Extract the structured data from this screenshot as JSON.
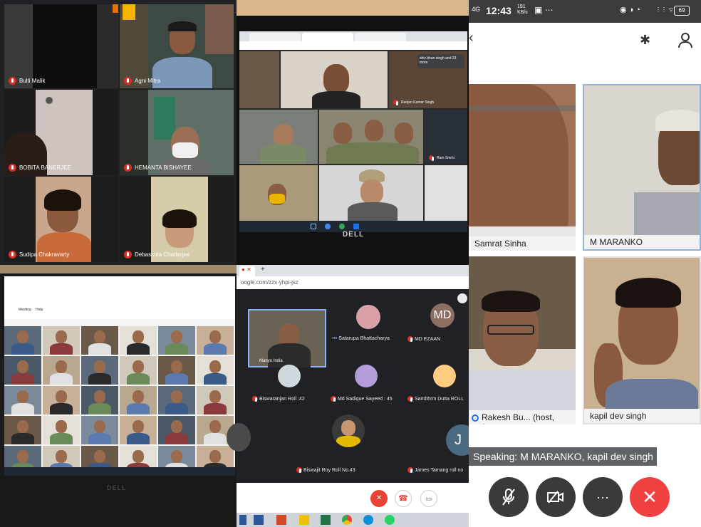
{
  "q1": {
    "participants": [
      {
        "name": "Bulti Malik"
      },
      {
        "name": "Agni Mitra"
      },
      {
        "name": "BOBITA BANERJEE"
      },
      {
        "name": "HEMANTA BISHAYEE"
      },
      {
        "name": "Sudipa Chakravarty"
      },
      {
        "name": "Debasmita Chatterjee"
      }
    ]
  },
  "q2": {
    "participants_label": "shiv bhan singh and 23 more",
    "tiles": [
      {
        "name": "Ranjan Kumar Singh"
      },
      {
        "name": "Ram Snehi"
      }
    ],
    "brand": "DELL"
  },
  "q3": {
    "menu": [
      "Meeting",
      "Help"
    ],
    "brand": "DELL"
  },
  "q4": {
    "url": "oogle.com/zzx-yhpi-jsz",
    "tiles": [
      {
        "name": "Satarupa Bhattacharya"
      },
      {
        "name": "MD EZAAN",
        "initials": "MD"
      },
      {
        "name": "Biswaranjan Roll :42"
      },
      {
        "name": "Md Sadique Sayeed : 45"
      },
      {
        "name": "Sambhrm Dutta ROLL"
      },
      {
        "name": "Biswajit Roy Roll No.43"
      },
      {
        "name": "James Tamang roll no"
      }
    ],
    "side_initial": "J",
    "presenter": "Manyo India"
  },
  "q5": {
    "status": {
      "signal": "4G",
      "time": "12:43",
      "data_rate": "191\nKB/s",
      "battery": "69"
    },
    "participants": [
      {
        "name": "Samrat Sinha"
      },
      {
        "name": "M MARANKO"
      },
      {
        "name": "Rakesh  Bu... (host, me)"
      },
      {
        "name": "kapil dev singh"
      }
    ],
    "speaking": "Speaking: M MARANKO, kapil dev singh",
    "controls": [
      "mute-mic",
      "stop-video",
      "more",
      "end-call"
    ],
    "colors": {
      "end_call": "#f04040",
      "control_bg": "#3a3a3a"
    }
  }
}
